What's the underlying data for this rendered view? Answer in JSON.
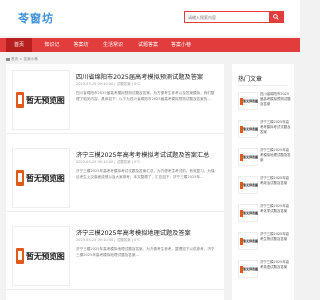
{
  "header": {
    "logo": "苓窗坊",
    "search_placeholder": "请输入搜索内容"
  },
  "nav": {
    "items": [
      "首页",
      "知识记",
      "答案坊",
      "生活常识",
      "试题答案",
      "答案小巷"
    ]
  },
  "breadcrumb": "首页 > 答案小巷",
  "placeholder_text": "暂无预览图",
  "articles": [
    {
      "title": "四川省绵阳市2025届高考模拟预测试题及答案",
      "meta": "2023-03-25 09:10:00  |  试题答案  |  0℃",
      "desc": "四川省绵阳市2025届高考模拟预测试题及答案，为方便考生参考以及答案模拟，我们整理了相关内容，具体如下：以下为四川省绵阳市2025届高考模拟预测试题及答案的..."
    },
    {
      "title": "济宁三模2025年高考考模拟考试试题及答案汇总",
      "meta": "2023-03-25 09:10:00  |  试题答案  |  0℃",
      "desc": "济宁三模2025年高考考模拟考试试题及答案汇总，为方便考生考试前，有效复习，为保证考生上交卷面成绩以及大家参考，本文整理了，汇总如下：济宁三模2025年..."
    },
    {
      "title": "济宁三模2025年高考模拟地理试题及答案",
      "meta": "2023-03-25 09:10:00  |  试题答案  |  0℃",
      "desc": "济宁三模2025年高考模拟地理试题及答案，为方便考生参考，整理如下以供参考，济宁三模2025年高考模拟地理试题及答案..."
    }
  ],
  "sidebar": {
    "title": "热门文章",
    "items": [
      "四川省绵阳市2025届高考模拟预测试题及答案",
      "济宁三模2025年高考考模拟考试试题及答案",
      "济宁三模2025年高考模拟地理试题及答案",
      "济宁三模2025年高考政治试题及答案",
      "济宁三模2025年高考化学试题及答案",
      "济宁三模2025年高考生物试题及答案",
      "济宁三模2025年高考英语试题及答案"
    ]
  }
}
